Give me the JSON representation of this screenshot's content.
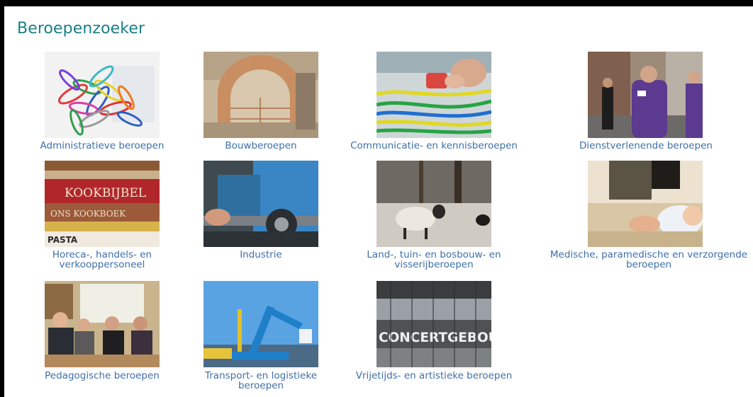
{
  "page_title": "Beroepenzoeker",
  "categories": [
    {
      "label_lines": [
        "Administratieve beroepen"
      ],
      "image": "paperclips-photo"
    },
    {
      "label_lines": [
        "Bouwberoepen"
      ],
      "image": "brick-arch-photo"
    },
    {
      "label_lines": [
        "Communicatie- en kennisberoepen"
      ],
      "image": "network-cables-photo"
    },
    {
      "label_lines": [
        "Dienstverlenende beroepen"
      ],
      "image": "street-stewards-photo"
    },
    {
      "label_lines": [
        "Horeca-, handels- en",
        "verkooppersoneel"
      ],
      "image": "cookbooks-photo",
      "book_texts": [
        "KOOKBIJBEL",
        "ONS KOOKBOEK",
        "PASTA"
      ]
    },
    {
      "label_lines": [
        "Industrie"
      ],
      "image": "lathe-machine-photo"
    },
    {
      "label_lines": [
        "Land-, tuin- en bosbouw- en",
        "visserijberoepen"
      ],
      "image": "sheep-field-photo"
    },
    {
      "label_lines": [
        "Medische, paramedische en verzorgende",
        "beroepen"
      ],
      "image": "baby-care-photo"
    },
    {
      "label_lines": [
        "Pedagogische beroepen"
      ],
      "image": "classroom-photo"
    },
    {
      "label_lines": [
        "Transport- en logistieke",
        "beroepen"
      ],
      "image": "harbor-crane-photo"
    },
    {
      "label_lines": [
        "Vrijetijds- en artistieke beroepen"
      ],
      "image": "concertgebouw-photo",
      "sign_text": "CONCERTGEBOUW"
    }
  ],
  "colors": {
    "title": "#1a7f86",
    "link": "#3f6fa8",
    "frame": "#000000"
  }
}
